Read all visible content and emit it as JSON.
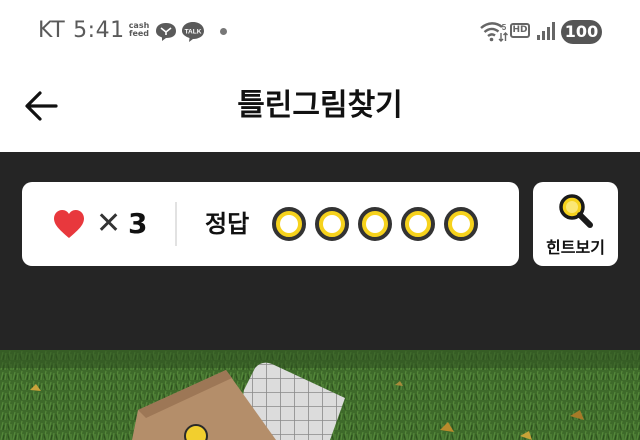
{
  "status_bar": {
    "carrier": "KT",
    "time": "5:41",
    "cashfeed_line1": "cash",
    "cashfeed_line2": "feed",
    "talk_label": "TALK",
    "hd_label": "HD",
    "battery": "100"
  },
  "header": {
    "title": "틀린그림찾기"
  },
  "game": {
    "times_sign": "✕",
    "lives": "3",
    "answer_label": "정답",
    "answer_slots": 5,
    "found": 0,
    "hint_label": "힌트보기"
  },
  "colors": {
    "dark_panel": "#252525",
    "heart": "#e8383d",
    "slot_ring": "#f6d21c",
    "grass": "#3f6b2b"
  }
}
